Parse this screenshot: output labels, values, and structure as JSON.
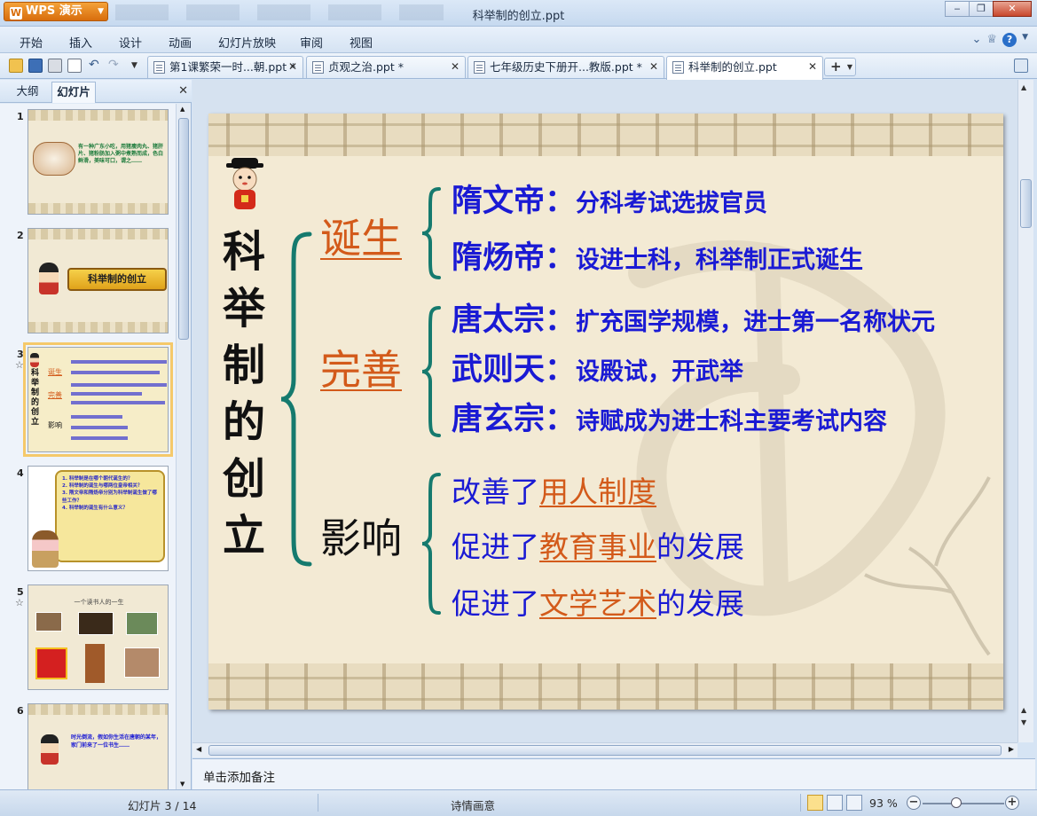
{
  "app": {
    "menu_label": "WPS 演示",
    "window_title": "科举制的创立.ppt"
  },
  "menubar": {
    "items": [
      "开始",
      "插入",
      "设计",
      "动画",
      "幻灯片放映",
      "审阅",
      "视图"
    ]
  },
  "tabs": [
    {
      "label": "第1课繁荣一时...朝.ppt *",
      "active": false
    },
    {
      "label": "贞观之治.ppt *",
      "active": false
    },
    {
      "label": "七年级历史下册开...教版.ppt *",
      "active": false
    },
    {
      "label": "科举制的创立.ppt",
      "active": true
    }
  ],
  "left_panel": {
    "tabs": [
      "大纲",
      "幻灯片"
    ],
    "active_tab": "幻灯片",
    "thumbnails": [
      {
        "num": "1",
        "text": "有一种广东小吃，用猪瘦肉丸、猪肝片、猪粉肠加入粥中煮熟而成，色白鲜滑，美味可口，谓之……"
      },
      {
        "num": "2",
        "text": "科举制的创立"
      },
      {
        "num": "3",
        "star": "☆",
        "selected": true
      },
      {
        "num": "4",
        "items": [
          "1. 科举制是在哪个朝代诞生的？",
          "2. 科举制的诞生与哪两位皇帝相关？",
          "3. 隋文帝和隋炀帝分别为科举制诞生做了哪些工作？",
          "4. 科举制的诞生有什么意义？"
        ]
      },
      {
        "num": "5",
        "star": "☆",
        "text": "一个读书人的一生"
      },
      {
        "num": "6",
        "text": "时光倒流，假如你生活在唐朝的某年，家门前来了一位书生……"
      }
    ]
  },
  "slide": {
    "title_chars": [
      "科",
      "举",
      "制",
      "的",
      "创",
      "立"
    ],
    "sections": [
      {
        "label": "诞生",
        "style": "underline-orange",
        "lines": [
          {
            "who": "隋文帝：",
            "what": "分科考试选拔官员"
          },
          {
            "who": "隋炀帝：",
            "what": "设进士科，科举制正式诞生"
          }
        ]
      },
      {
        "label": "完善",
        "style": "underline-orange",
        "lines": [
          {
            "who": "唐太宗：",
            "what": "扩充国学规模，进士第一名称状元"
          },
          {
            "who": "武则天：",
            "what": "设殿试，开武举"
          },
          {
            "who": "唐玄宗：",
            "what": "诗赋成为进士科主要考试内容"
          }
        ]
      },
      {
        "label": "影响",
        "style": "plain",
        "lines": [
          {
            "pre": "改善了",
            "hl": "用人制度",
            "post": ""
          },
          {
            "pre": "促进了",
            "hl": "教育事业",
            "post": "的发展"
          },
          {
            "pre": "促进了",
            "hl": "文学艺术",
            "post": "的发展"
          }
        ]
      }
    ]
  },
  "notes": {
    "placeholder": "单击添加备注"
  },
  "status": {
    "slide_counter": "幻灯片 3 / 14",
    "theme": "诗情画意",
    "zoom": "93 %"
  },
  "colors": {
    "accent_orange": "#d35a1a",
    "slide_blue": "#1a1ad4",
    "brace_teal": "#157a6e"
  }
}
